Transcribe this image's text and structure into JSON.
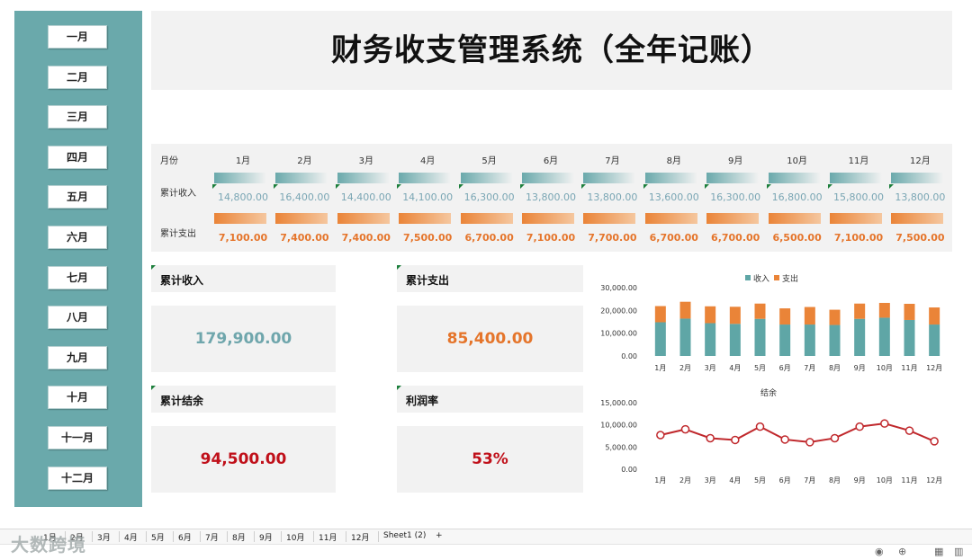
{
  "title": "财务收支管理系统（全年记账）",
  "nav": {
    "buttons": [
      "一月",
      "二月",
      "三月",
      "四月",
      "五月",
      "六月",
      "七月",
      "八月",
      "九月",
      "十月",
      "十一月",
      "十二月"
    ]
  },
  "table": {
    "header_label": "月份",
    "income_label": "累计收入",
    "expense_label": "累计支出",
    "months": [
      "1月",
      "2月",
      "3月",
      "4月",
      "5月",
      "6月",
      "7月",
      "8月",
      "9月",
      "10月",
      "11月",
      "12月"
    ],
    "income_values": [
      "14,800.00",
      "16,400.00",
      "14,400.00",
      "14,100.00",
      "16,300.00",
      "13,800.00",
      "13,800.00",
      "13,600.00",
      "16,300.00",
      "16,800.00",
      "15,800.00",
      "13,800.00"
    ],
    "expense_values": [
      "7,100.00",
      "7,400.00",
      "7,400.00",
      "7,500.00",
      "6,700.00",
      "7,100.00",
      "7,700.00",
      "6,700.00",
      "6,700.00",
      "6,500.00",
      "7,100.00",
      "7,500.00"
    ]
  },
  "kpi": {
    "income_label": "累计收入",
    "income_value": "179,900.00",
    "expense_label": "累计支出",
    "expense_value": "85,400.00",
    "balance_label": "累计结余",
    "balance_value": "94,500.00",
    "profit_label": "利润率",
    "profit_value": "53%"
  },
  "colors": {
    "teal": "#6aa9ab",
    "income_bar": "#5fa6a6",
    "expense_bar": "#ea8438",
    "balance_line": "#c0282c",
    "income_text": "#6fa6ac",
    "expense_text": "#e5752b",
    "balance_text": "#c0101a"
  },
  "chart_data": [
    {
      "type": "bar",
      "stacked": true,
      "title": "",
      "categories": [
        "1月",
        "2月",
        "3月",
        "4月",
        "5月",
        "6月",
        "7月",
        "8月",
        "9月",
        "10月",
        "11月",
        "12月"
      ],
      "series": [
        {
          "name": "收入",
          "values": [
            14800,
            16400,
            14400,
            14100,
            16300,
            13800,
            13800,
            13600,
            16300,
            16800,
            15800,
            13800
          ]
        },
        {
          "name": "支出",
          "values": [
            7100,
            7400,
            7400,
            7500,
            6700,
            7100,
            7700,
            6700,
            6700,
            6500,
            7100,
            7500
          ]
        }
      ],
      "yticks": [
        "0.00",
        "10,000.00",
        "20,000.00",
        "30,000.00"
      ],
      "ylim": [
        0,
        30000
      ],
      "legend": "top-center",
      "grid": false
    },
    {
      "type": "line",
      "title": "结余",
      "categories": [
        "1月",
        "2月",
        "3月",
        "4月",
        "5月",
        "6月",
        "7月",
        "8月",
        "9月",
        "10月",
        "11月",
        "12月"
      ],
      "series": [
        {
          "name": "",
          "values": [
            7700,
            9000,
            7000,
            6600,
            9600,
            6700,
            6100,
            7000,
            9600,
            10300,
            8700,
            6300
          ]
        }
      ],
      "yticks": [
        "0.00",
        "5,000.00",
        "10,000.00",
        "15,000.00"
      ],
      "ylim": [
        0,
        15000
      ],
      "legend": "none",
      "grid": false
    }
  ],
  "tabs": [
    "1月",
    "2月",
    "3月",
    "4月",
    "5月",
    "6月",
    "7月",
    "8月",
    "9月",
    "10月",
    "11月",
    "12月",
    "Sheet1 (2)",
    "+"
  ],
  "watermark": "大数跨境"
}
